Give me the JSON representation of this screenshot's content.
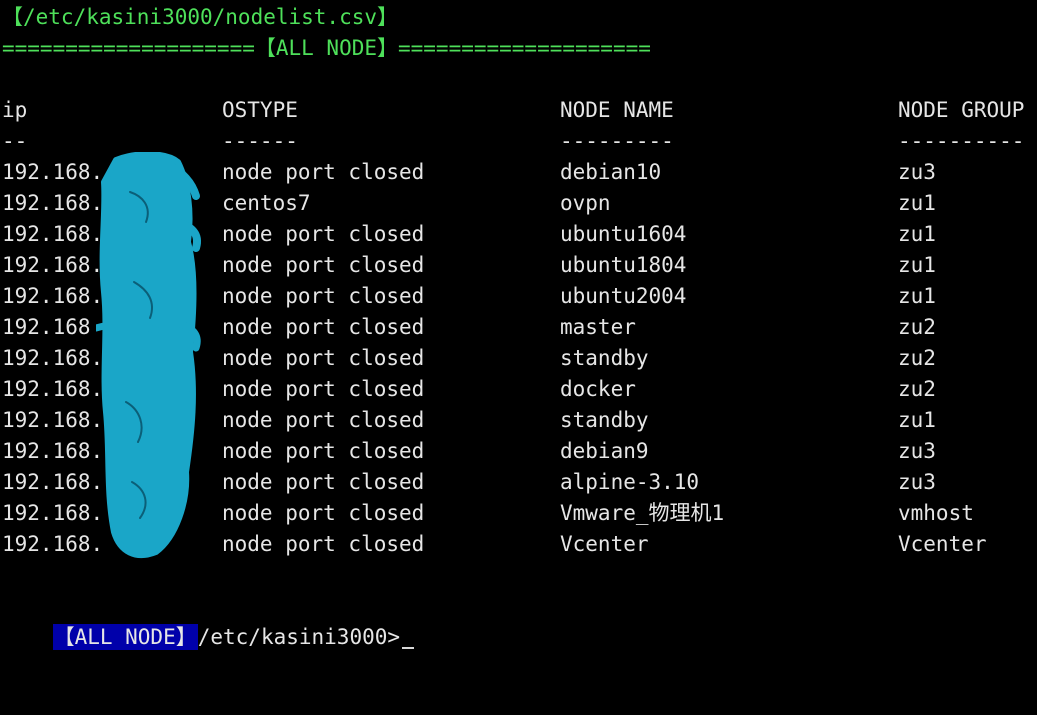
{
  "terminal": {
    "file_path_line": "【/etc/kasini3000/nodelist.csv】",
    "banner_line": "====================【ALL NODE】====================",
    "colors": {
      "background": "#000000",
      "text": "#e6e6e6",
      "green": "#4ee05a",
      "prompt_badge_bg": "#0000aa",
      "redaction": "#1aa6c8"
    }
  },
  "table": {
    "headers": {
      "ip": "ip",
      "ostype": "OSTYPE",
      "node_name": "NODE NAME",
      "node_group": "NODE GROUP"
    },
    "separators": {
      "ip": "--",
      "ostype": "------",
      "node_name": "---------",
      "node_group": "----------"
    },
    "rows": [
      {
        "ip": "192.168.",
        "ostype": "node port closed",
        "node_name": "debian10",
        "node_group": "zu3"
      },
      {
        "ip": "192.168.",
        "ostype": "centos7",
        "node_name": "ovpn",
        "node_group": "zu1"
      },
      {
        "ip": "192.168.",
        "ostype": "node port closed",
        "node_name": "ubuntu1604",
        "node_group": "zu1"
      },
      {
        "ip": "192.168.",
        "ostype": "node port closed",
        "node_name": "ubuntu1804",
        "node_group": "zu1"
      },
      {
        "ip": "192.168.",
        "ostype": "node port closed",
        "node_name": "ubuntu2004",
        "node_group": "zu1"
      },
      {
        "ip": "192.168",
        "ostype": "node port closed",
        "node_name": "master",
        "node_group": "zu2"
      },
      {
        "ip": "192.168.",
        "ostype": "node port closed",
        "node_name": "standby",
        "node_group": "zu2"
      },
      {
        "ip": "192.168.",
        "ostype": "node port closed",
        "node_name": "docker",
        "node_group": "zu2"
      },
      {
        "ip": "192.168.",
        "ostype": "node port closed",
        "node_name": "standby",
        "node_group": "zu1"
      },
      {
        "ip": "192.168.",
        "ostype": "node port closed",
        "node_name": "debian9",
        "node_group": "zu3"
      },
      {
        "ip": "192.168.",
        "ostype": "node port closed",
        "node_name": "alpine-3.10",
        "node_group": "zu3"
      },
      {
        "ip": "192.168.",
        "ostype": "node port closed",
        "node_name": "Vmware_物理机1",
        "node_group": "vmhost"
      },
      {
        "ip": "192.168.",
        "ostype": "node port closed",
        "node_name": "Vcenter",
        "node_group": "Vcenter"
      }
    ]
  },
  "prompt": {
    "badge": "【ALL NODE】",
    "path": "/etc/kasini3000>"
  }
}
